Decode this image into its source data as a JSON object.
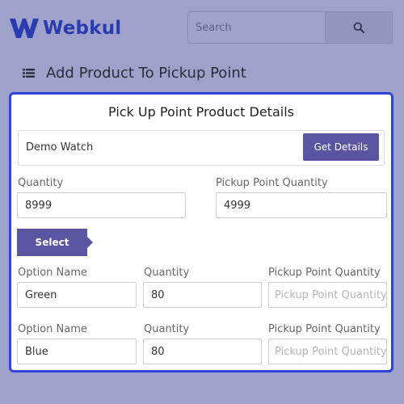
{
  "header": {
    "logo_text": "Webkul",
    "search_placeholder": "Search",
    "brand_color": "#2a3bb0"
  },
  "page": {
    "title": "Add Product To Pickup Point"
  },
  "panel": {
    "title": "Pick Up Point Product Details",
    "product": {
      "name": "Demo Watch",
      "get_details_label": "Get Details"
    },
    "quantity": {
      "label": "Quantity",
      "value": "8999"
    },
    "pickup_quantity": {
      "label": "Pickup Point Quantity",
      "value": "4999"
    },
    "select_label": "Select",
    "options": [
      {
        "option_name_label": "Option Name",
        "option_name": "Green",
        "quantity_label": "Quantity",
        "quantity": "80",
        "pickup_label": "Pickup Point Quantity",
        "pickup_placeholder": "Pickup Point Quantity"
      },
      {
        "option_name_label": "Option Name",
        "option_name": "Blue",
        "quantity_label": "Quantity",
        "quantity": "80",
        "pickup_label": "Pickup Point Quantity",
        "pickup_placeholder": "Pickup Point Quantity"
      }
    ],
    "accent_color": "#5a55a0",
    "border_color": "#2d44d6"
  }
}
